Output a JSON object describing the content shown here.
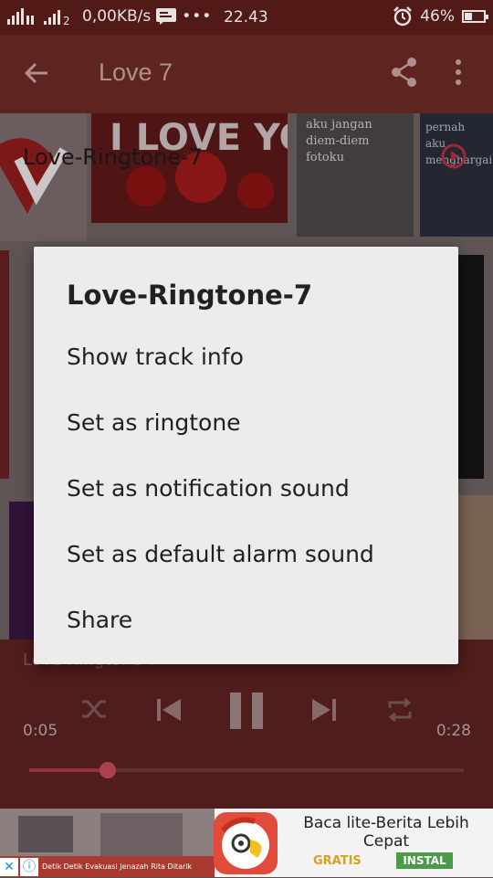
{
  "status_bar": {
    "data_speed": "0,00KB/s",
    "time": "22.43",
    "battery": "46%",
    "battery_level": 0.46,
    "icons": [
      "signal-icon",
      "signal-icon",
      "message-icon",
      "more-icon",
      "alarm-icon",
      "battery-icon"
    ]
  },
  "toolbar": {
    "title": "Love 7",
    "back_icon": "arrow-back-icon",
    "share_icon": "share-icon",
    "more_icon": "more-vert-icon"
  },
  "content": {
    "overlay_title": "Love-Ringtone-7",
    "tiles": [
      "I LOVE YOU",
      "aku jangan diem-diem fotoku",
      "pernah aku menghargai"
    ]
  },
  "player": {
    "now_playing": "Love-Ringtone-7",
    "elapsed": "0:05",
    "total": "0:28",
    "progress": 0.18
  },
  "dialog": {
    "title": "Love-Ringtone-7",
    "items": [
      "Show track info",
      "Set as ringtone",
      "Set as notification sound",
      "Set as default alarm sound",
      "Share"
    ]
  },
  "ad": {
    "headline": "Baca lite-Berita Lebih Cepat",
    "price": "GRATIS",
    "cta": "INSTAL",
    "caption": "Detik Detik Evakuasi Jenazah Rita Ditarik"
  },
  "colors": {
    "status": "#511a17",
    "toolbar": "#6a2a25",
    "dialog": "#ececec",
    "accent": "#c44a55"
  }
}
